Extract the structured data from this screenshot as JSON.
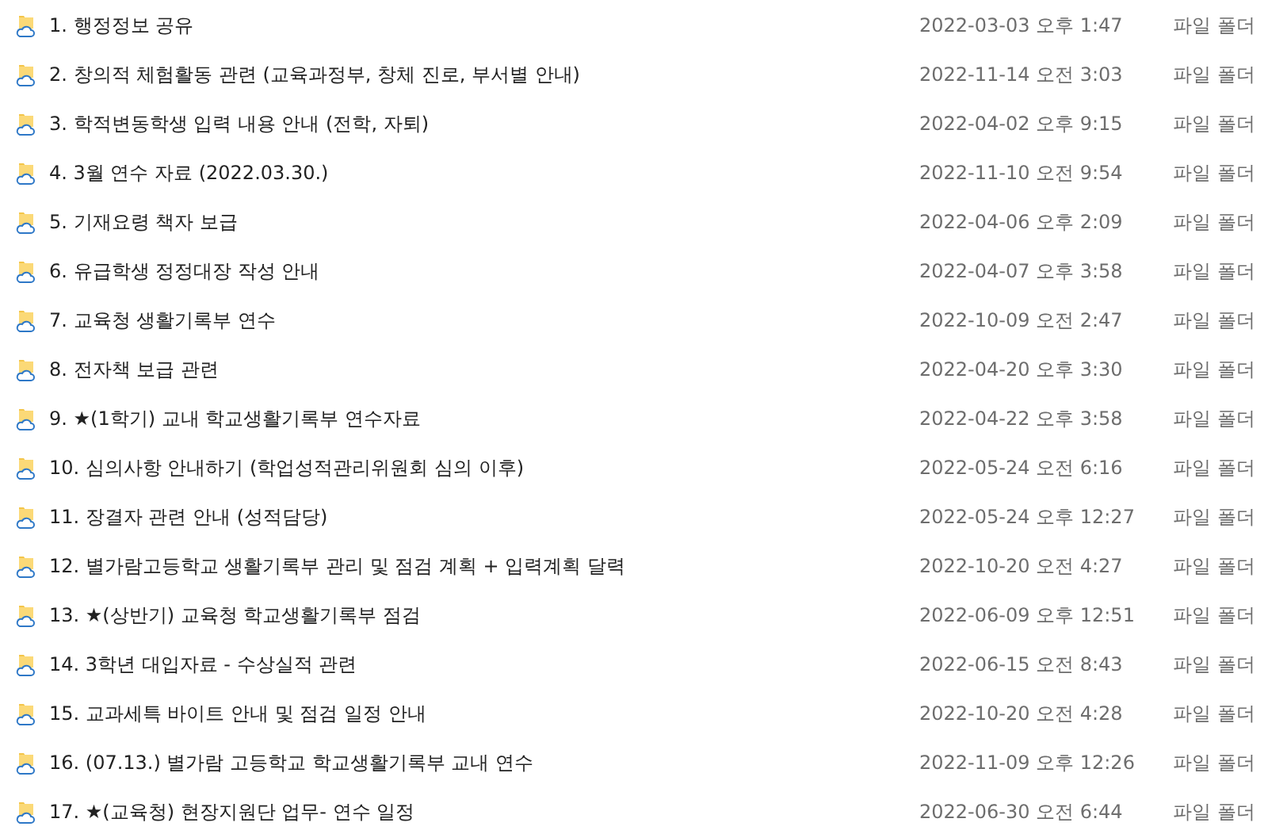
{
  "files": [
    {
      "name": "1. 행정정보 공유",
      "modified": "2022-03-03 오후 1:47",
      "type": "파일 폴더"
    },
    {
      "name": "2. 창의적 체험활동 관련 (교육과정부, 창체 진로, 부서별 안내)",
      "modified": "2022-11-14 오전 3:03",
      "type": "파일 폴더"
    },
    {
      "name": "3. 학적변동학생 입력 내용 안내 (전학, 자퇴)",
      "modified": "2022-04-02 오후 9:15",
      "type": "파일 폴더"
    },
    {
      "name": "4. 3월 연수 자료 (2022.03.30.)",
      "modified": "2022-11-10 오전 9:54",
      "type": "파일 폴더"
    },
    {
      "name": "5. 기재요령 책자 보급",
      "modified": "2022-04-06 오후 2:09",
      "type": "파일 폴더"
    },
    {
      "name": "6. 유급학생 정정대장 작성 안내",
      "modified": "2022-04-07 오후 3:58",
      "type": "파일 폴더"
    },
    {
      "name": "7. 교육청 생활기록부 연수",
      "modified": "2022-10-09 오전 2:47",
      "type": "파일 폴더"
    },
    {
      "name": "8. 전자책 보급 관련",
      "modified": "2022-04-20 오후 3:30",
      "type": "파일 폴더"
    },
    {
      "name": "9. ★(1학기) 교내 학교생활기록부 연수자료",
      "modified": "2022-04-22 오후 3:58",
      "type": "파일 폴더"
    },
    {
      "name": "10. 심의사항 안내하기 (학업성적관리위원회 심의 이후)",
      "modified": "2022-05-24 오전 6:16",
      "type": "파일 폴더"
    },
    {
      "name": "11. 장결자 관련 안내 (성적담당)",
      "modified": "2022-05-24 오후 12:27",
      "type": "파일 폴더"
    },
    {
      "name": "12. 별가람고등학교 생활기록부 관리 및 점검 계획 + 입력계획 달력",
      "modified": "2022-10-20 오전 4:27",
      "type": "파일 폴더"
    },
    {
      "name": "13. ★(상반기) 교육청 학교생활기록부 점검",
      "modified": "2022-06-09 오후 12:51",
      "type": "파일 폴더"
    },
    {
      "name": "14. 3학년 대입자료 - 수상실적 관련",
      "modified": "2022-06-15 오전 8:43",
      "type": "파일 폴더"
    },
    {
      "name": "15. 교과세특 바이트 안내 및 점검 일정 안내",
      "modified": "2022-10-20 오전 4:28",
      "type": "파일 폴더"
    },
    {
      "name": "16. (07.13.) 별가람 고등학교 학교생활기록부 교내 연수",
      "modified": "2022-11-09 오후 12:26",
      "type": "파일 폴더"
    },
    {
      "name": "17. ★(교육청) 현장지원단 업무- 연수 일정",
      "modified": "2022-06-30 오전 6:44",
      "type": "파일 폴더"
    }
  ]
}
